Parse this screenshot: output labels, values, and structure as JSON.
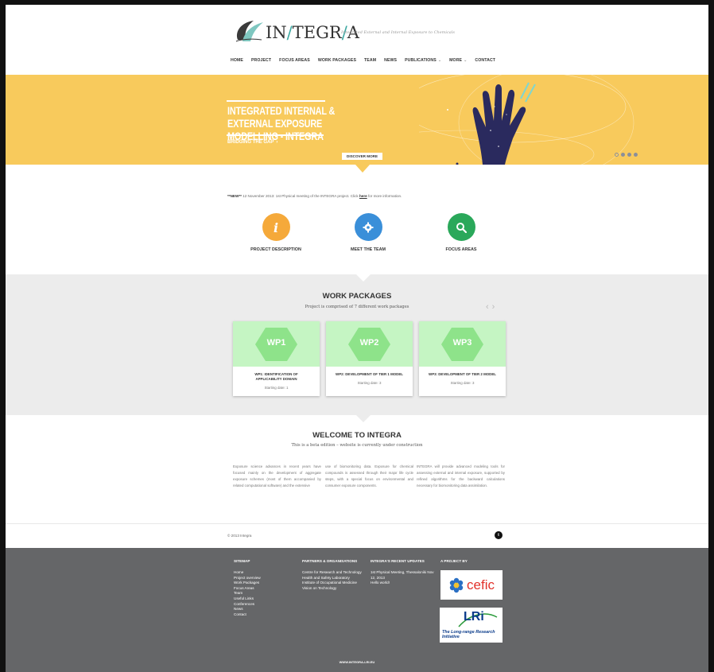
{
  "header": {
    "logo_text_a": "IN",
    "logo_text_slash": "/",
    "logo_text_b": "TEGR",
    "logo_text_slash2": "/",
    "logo_text_c": "A",
    "tagline": "Integrated External and Internal Exposure to Chemicals",
    "nav": [
      {
        "label": "HOME"
      },
      {
        "label": "PROJECT"
      },
      {
        "label": "FOCUS AREAS"
      },
      {
        "label": "WORK PACKAGES"
      },
      {
        "label": "TEAM"
      },
      {
        "label": "NEWS"
      },
      {
        "label": "PUBLICATIONS",
        "caret": "⌄"
      },
      {
        "label": "MORE",
        "caret": "⌄"
      },
      {
        "label": "CONTACT"
      }
    ]
  },
  "hero": {
    "title": "INTEGRATED INTERNAL & EXTERNAL EXPOSURE MODELLING - INTEGRA",
    "cta": "BRIDGING THE GAP",
    "cta_arrow": "›",
    "discover": "DISCOVER MORE",
    "slides": 4,
    "active_slide": 1,
    "colors": {
      "background": "#f8ca5c",
      "hand": "#2a2a5e"
    }
  },
  "news": {
    "tag": "**NEW**",
    "text_before": " 12 November 2013: 1st Physical meeting of the INTEGRA project. Click ",
    "link": "here",
    "text_after": " for more information."
  },
  "features": [
    {
      "label": "PROJECT DESCRIPTION",
      "icon": "info-icon",
      "color": "#f5a93a"
    },
    {
      "label": "MEET THE TEAM",
      "icon": "gear-icon",
      "color": "#3a8fd9"
    },
    {
      "label": "FOCUS AREAS",
      "icon": "search-icon",
      "color": "#2aa85a"
    }
  ],
  "work_packages": {
    "title": "WORK PACKAGES",
    "subtitle": "Project is comprised of 7 different work packages",
    "prev": "‹",
    "next": "›",
    "cards": [
      {
        "badge": "WP1",
        "title": "WP1: IDENTIFICATION OF APPLICABILITY DOMAIN",
        "date": "Starting date: 1"
      },
      {
        "badge": "WP2",
        "title": "WP2: DEVELOPMENT OF TIER 1 MODEL",
        "date": "Starting date: 3"
      },
      {
        "badge": "WP3",
        "title": "WP3: DEVELOPMENT OF TIER 2 MODEL",
        "date": "Starting date: 3"
      }
    ]
  },
  "welcome": {
    "title": "WELCOME TO INTEGRA",
    "subtitle": "This is a beta edition – website is currently under construction",
    "columns": [
      "Exposure science advances in recent years have focused mainly on the development of aggregate exposure schemes (most of them accompanied by related computational software) and the extensive",
      "use of biomonitoring data. Exposure for chemical compounds is assessed through their major life cycle steps, with a special focus on environmental and consumer exposure components.",
      "INTEGRA will provide advanced modeling tools for assessing external and internal exposure, supported by refined algorithms for the backward calculations necessary for biomonitoring data assimilation."
    ]
  },
  "bottombar": {
    "copyright": "© 2013 Integra",
    "social_glyph": "t"
  },
  "footer": {
    "sitemap": {
      "heading": "SITEMAP",
      "items": [
        "Home",
        "Project overview",
        "Work Packages",
        "Focus Areas",
        "Team",
        "Useful Links",
        "Conferences",
        "News",
        "Contact"
      ]
    },
    "partners": {
      "heading": "PARTNERS & ORGANISATIONS",
      "items": [
        "Centre for Research and Technology",
        "Health and Safety Laboratory",
        "Institute of Occupational Medicine",
        "Vision on Technology"
      ]
    },
    "updates": {
      "heading": "INTEGRA'S RECENT UPDATES",
      "items": [
        "1st Physical Meeting, Thessaloniki Nov 12, 2013",
        "Hello world!"
      ]
    },
    "project_by": {
      "heading": "A PROJECT BY",
      "cefic": "cefic",
      "lri_big": "LRi",
      "lri_small": "The Long-range Research Initiative"
    },
    "url": "WWW.INTEGRA-LRI.EU"
  }
}
